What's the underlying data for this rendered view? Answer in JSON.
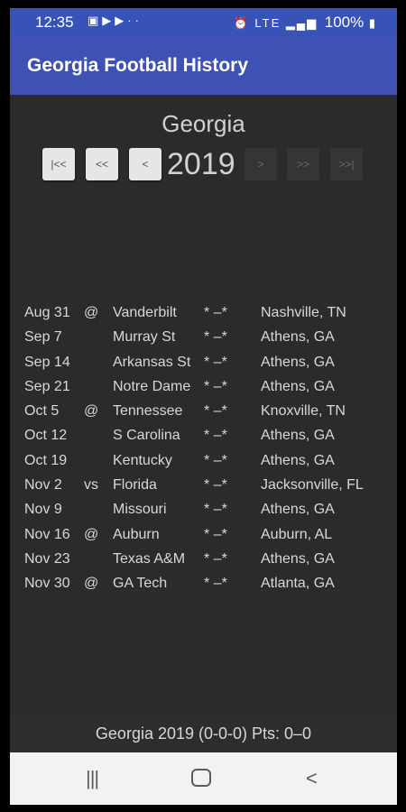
{
  "status_bar": {
    "time": "12:35",
    "notification_icons": [
      "photo-icon",
      "play-icon",
      "youtube-icon"
    ],
    "notification_more": "··",
    "system_icons": [
      "alarm-icon",
      "lte-icon",
      "signal-icon"
    ],
    "lte_label": "LTE",
    "battery": "100%"
  },
  "app_bar": {
    "title": "Georgia Football History"
  },
  "team": "Georgia",
  "nav": {
    "first_label": "|<<",
    "prev_fast_label": "<<",
    "prev_label": "<",
    "year": "2019",
    "next_label": ">",
    "next_fast_label": ">>",
    "last_label": ">>|"
  },
  "games": [
    {
      "date": "Aug 31",
      "loc": "@",
      "opponent": "Vanderbilt",
      "score": "* –*",
      "site": "Nashville, TN"
    },
    {
      "date": "Sep 7",
      "loc": "",
      "opponent": "Murray St",
      "score": "* –*",
      "site": "Athens, GA"
    },
    {
      "date": "Sep 14",
      "loc": "",
      "opponent": "Arkansas St",
      "score": "* –*",
      "site": "Athens, GA"
    },
    {
      "date": "Sep 21",
      "loc": "",
      "opponent": "Notre Dame",
      "score": "* –*",
      "site": "Athens, GA"
    },
    {
      "date": "Oct 5",
      "loc": "@",
      "opponent": "Tennessee",
      "score": "* –*",
      "site": "Knoxville, TN"
    },
    {
      "date": "Oct 12",
      "loc": "",
      "opponent": "S Carolina",
      "score": "* –*",
      "site": "Athens, GA"
    },
    {
      "date": "Oct 19",
      "loc": "",
      "opponent": "Kentucky",
      "score": "* –*",
      "site": "Athens, GA"
    },
    {
      "date": "Nov 2",
      "loc": "vs",
      "opponent": "Florida",
      "score": "* –*",
      "site": "Jacksonville, FL"
    },
    {
      "date": "Nov 9",
      "loc": "",
      "opponent": "Missouri",
      "score": "* –*",
      "site": "Athens, GA"
    },
    {
      "date": "Nov 16",
      "loc": "@",
      "opponent": "Auburn",
      "score": "* –*",
      "site": "Auburn, AL"
    },
    {
      "date": "Nov 23",
      "loc": "",
      "opponent": "Texas A&M",
      "score": "* –*",
      "site": "Athens, GA"
    },
    {
      "date": "Nov 30",
      "loc": "@",
      "opponent": "GA Tech",
      "score": "* –*",
      "site": "Atlanta, GA"
    }
  ],
  "summary": "Georgia 2019 (0-0-0) Pts:  0–0",
  "colors": {
    "app_bar": "#3f51b5",
    "status_bar": "#3853b8",
    "background": "#2b2b2b",
    "text": "#d8d8d8"
  }
}
